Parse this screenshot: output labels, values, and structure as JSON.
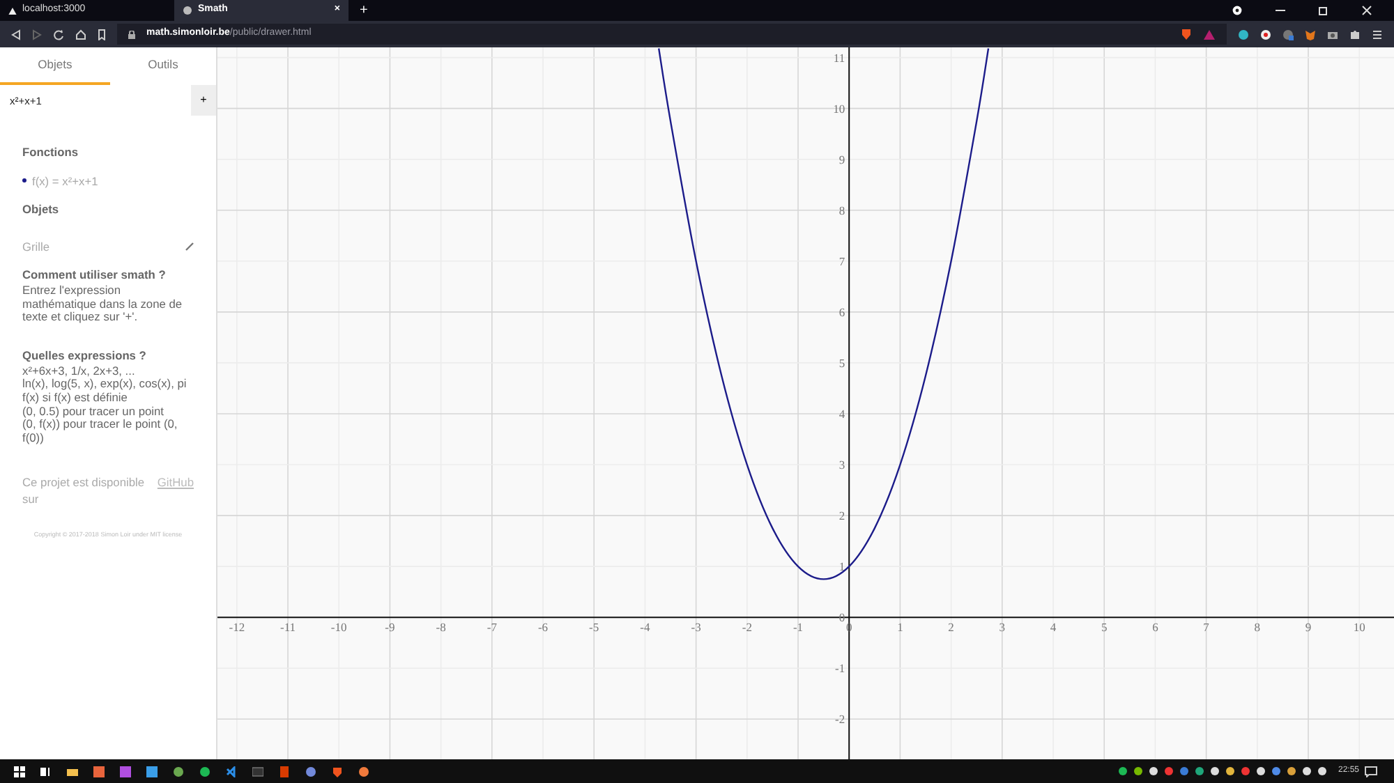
{
  "browser": {
    "tabs": [
      {
        "label": "localhost:3000",
        "selected": false
      },
      {
        "label": "Smath",
        "selected": true,
        "close": "×"
      }
    ],
    "new_tab": "+",
    "address": {
      "domain": "math.simonloir.be",
      "path": "/public/drawer.html"
    }
  },
  "sidebar": {
    "tabs": [
      {
        "label": "Objets",
        "selected": true
      },
      {
        "label": "Outils",
        "selected": false
      }
    ],
    "expression": {
      "value": "x²+x+1"
    },
    "add_button": "+",
    "functions_heading": "Fonctions",
    "functions": [
      {
        "label": "f(x) = x²+x+1",
        "color": "#1c1c8a"
      }
    ],
    "objects_heading": "Objets",
    "objects": [
      {
        "label": "Grille"
      }
    ],
    "help": [
      {
        "title": "Comment utiliser smath ?",
        "lines": [
          "Entrez l'expression mathématique dans la zone de texte et cliquez sur '+'."
        ]
      },
      {
        "title": "Quelles expressions ?",
        "lines": [
          "x²+6x+3, 1/x, 2x+3, ...",
          "ln(x), log(5, x), exp(x), cos(x), pi",
          "f(x) si f(x) est définie",
          "(0, 0.5) pour tracer un point",
          "(0, f(x)) pour tracer le point (0, f(0))"
        ]
      }
    ],
    "footer": {
      "text": "Ce projet est disponible sur",
      "link": "GitHub"
    },
    "copyright": "Copyright © 2017-2018 Simon Loir under MIT license"
  },
  "graph": {
    "chart_data": {
      "type": "line",
      "grid": true,
      "x": [
        -3.73,
        -3.5,
        -3,
        -2.5,
        -2,
        -1.5,
        -1,
        -0.5,
        0,
        0.5,
        1,
        1.5,
        2,
        2.5,
        2.73
      ],
      "series": [
        {
          "color": "#1c1c8a",
          "values": [
            11.18,
            9.75,
            7,
            4.75,
            3,
            1.75,
            1,
            0.75,
            1,
            1.75,
            3,
            4.75,
            7,
            9.75,
            11.18
          ]
        }
      ],
      "xlim": [
        -12.38,
        10.68
      ],
      "ylim": [
        -2.79,
        11.2
      ],
      "xticks": [
        -12,
        -11,
        -10,
        -9,
        -8,
        -7,
        -6,
        -5,
        -4,
        -3,
        -2,
        -1,
        0,
        1,
        2,
        3,
        4,
        5,
        6,
        7,
        8,
        9,
        10
      ],
      "yticks": [
        -2,
        -1,
        0,
        1,
        2,
        3,
        4,
        5,
        6,
        7,
        8,
        9,
        10,
        11
      ]
    }
  },
  "taskbar": {
    "time": "22:55"
  }
}
